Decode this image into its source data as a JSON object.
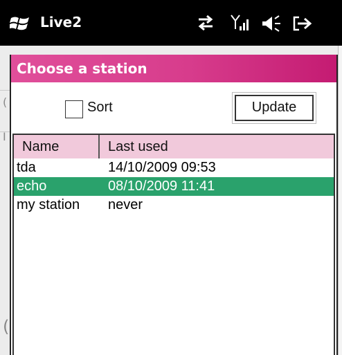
{
  "statusbar": {
    "app_title": "Live2",
    "icons": [
      "windows-logo-icon",
      "data-connection-icon",
      "signal-strength-icon",
      "volume-icon",
      "exit-icon"
    ]
  },
  "dialog": {
    "title": "Choose a station",
    "sort_label": "Sort",
    "sort_checked": false,
    "update_label": "Update",
    "columns": [
      "Name",
      "Last used"
    ],
    "rows": [
      {
        "name": "tda",
        "last_used": "14/10/2009 09:53",
        "selected": false
      },
      {
        "name": "echo",
        "last_used": "08/10/2009 11:41",
        "selected": true
      },
      {
        "name": "my station",
        "last_used": "never",
        "selected": false
      }
    ]
  },
  "colors": {
    "title_gradient_start": "#e04f9a",
    "title_gradient_end": "#c41b72",
    "header_bg": "#f1c9db",
    "selection": "#2aa26c"
  }
}
